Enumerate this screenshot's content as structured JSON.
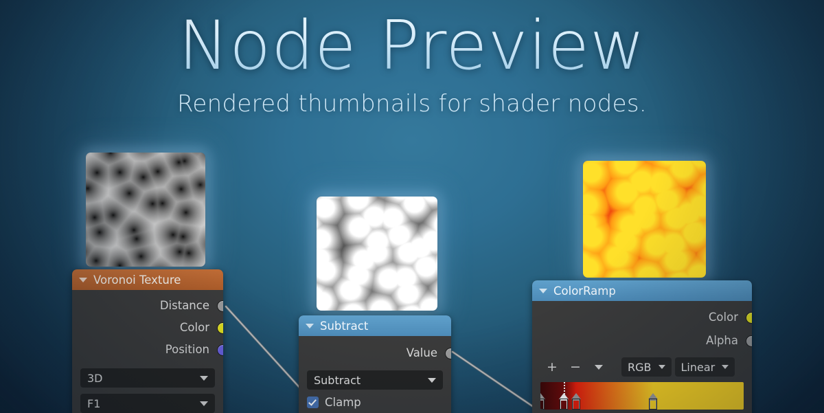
{
  "hero": {
    "title": "Node Preview",
    "subtitle": "Rendered thumbnails for shader nodes."
  },
  "theme": {
    "bg_center": "#35799c",
    "bg_edge": "#11293f",
    "title_color": "#ddeffb",
    "subtitle_color": "#cfe8f7",
    "header_orange": "#b5622f",
    "header_blue": "#5295c5",
    "node_body": "#3b3b3b",
    "widget_bg": "#232323",
    "socket_gray": "#9b9b9b",
    "socket_yellow": "#e2e01f",
    "socket_purple": "#6a61e0",
    "checkbox_blue": "#4772b3",
    "wire_color": "#9a9a9a"
  },
  "thumbnails": [
    {
      "name": "voronoi-distance-preview",
      "style": "voronoi_distance",
      "colors": [
        "#000000",
        "#ffffff"
      ]
    },
    {
      "name": "subtract-result-preview",
      "style": "blobs_bw",
      "colors": [
        "#000000",
        "#ffffff"
      ]
    },
    {
      "name": "colorramp-result-preview",
      "style": "blobs_fire",
      "colors": [
        "#3b0606",
        "#e81e0a",
        "#ff9a14",
        "#ffe02a"
      ]
    }
  ],
  "nodes": {
    "voronoi": {
      "title": "Voronoi Texture",
      "header_color": "#b5622f",
      "outputs": [
        {
          "label": "Distance",
          "socket": "gray"
        },
        {
          "label": "Color",
          "socket": "yellow"
        },
        {
          "label": "Position",
          "socket": "purple"
        }
      ],
      "widgets": [
        {
          "label": "3D"
        },
        {
          "label": "F1"
        }
      ]
    },
    "subtract": {
      "title": "Subtract",
      "header_color": "#5295c5",
      "outputs": [
        {
          "label": "Value",
          "socket": "gray"
        }
      ],
      "widgets": [
        {
          "label": "Subtract"
        }
      ],
      "checkbox": {
        "label": "Clamp",
        "checked": true
      }
    },
    "colorramp": {
      "title": "ColorRamp",
      "header_color": "#5295c5",
      "outputs": [
        {
          "label": "Color",
          "socket": "yellow"
        },
        {
          "label": "Alpha",
          "socket": "gray"
        }
      ],
      "tools": [
        {
          "name": "add-stop-button",
          "glyph": "+"
        },
        {
          "name": "remove-stop-button",
          "glyph": "−"
        },
        {
          "name": "ramp-menu-button",
          "glyph": "chevron"
        }
      ],
      "selects": [
        {
          "label": "RGB"
        },
        {
          "label": "Linear"
        }
      ],
      "ramp": {
        "stops": [
          {
            "position": 0.0,
            "color": "#3b0606",
            "selected": false
          },
          {
            "position": 0.115,
            "color": "#6e0a08",
            "selected": true
          },
          {
            "position": 0.175,
            "color": "#e81e0a",
            "selected": false
          },
          {
            "position": 0.555,
            "color": "#ffd723",
            "selected": false
          }
        ]
      }
    }
  }
}
